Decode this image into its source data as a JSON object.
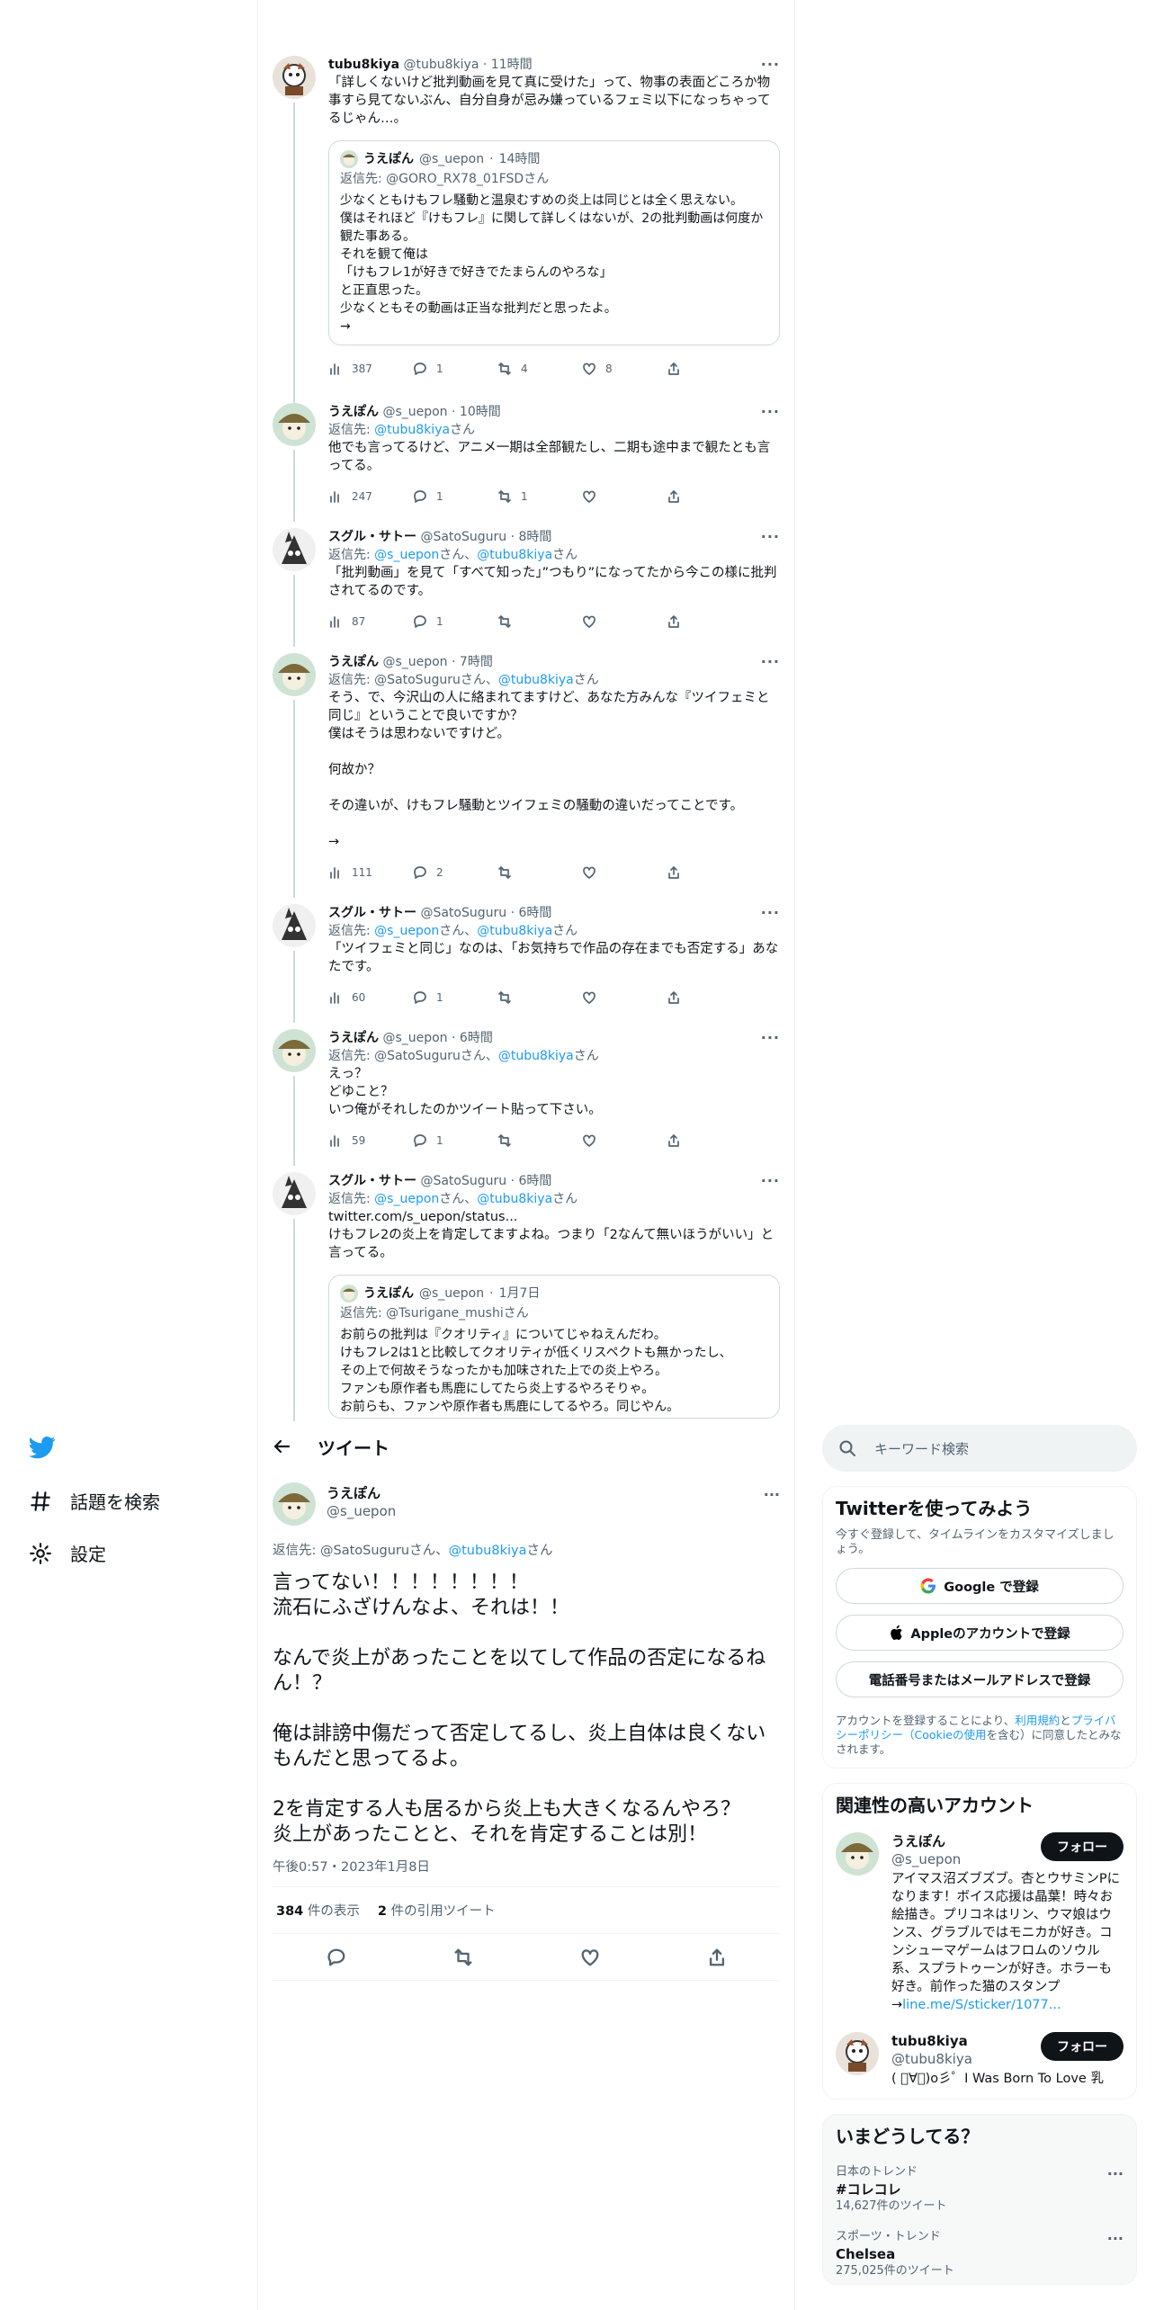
{
  "colors": {
    "accent": "#1d9bf0",
    "text": "#0f1419",
    "muted": "#536471",
    "border": "#eff3f4"
  },
  "thread": [
    {
      "name": "tubu8kiya",
      "handle": "@tubu8kiya",
      "time": "11時間",
      "reply_prefix": "",
      "reply_links": [],
      "body": "「詳しくないけど批判動画を見て真に受けた」って、物事の表面どころか物事すら見てないぶん、自分自身が忌み嫌っているフェミ以下になっちゃってるじゃん…。",
      "quote": {
        "name": "うえぽん",
        "handle": "@s_uepon",
        "time": "14時間",
        "reply": "返信先: @GORO_RX78_01FSDさん",
        "body": "少なくともけもフレ騒動と温泉むすめの炎上は同じとは全く思えない。\n僕はそれほど『けもフレ』に関して詳しくはないが、2の批判動画は何度か観た事ある。\nそれを観て俺は\n「けもフレ1が好きで好きでたまらんのやろな」\nと正直思った。\n少なくともその動画は正当な批判だと思ったよ。\n→"
      },
      "stats": {
        "views": "387",
        "replies": "1",
        "retweets": "4",
        "likes": "8"
      }
    },
    {
      "name": "うえぽん",
      "handle": "@s_uepon",
      "time": "10時間",
      "reply_prefix": "返信先:",
      "reply_links": [
        "@tubu8kiya"
      ],
      "reply_suffix": "さん",
      "body": "他でも言ってるけど、アニメ一期は全部観たし、二期も途中まで観たとも言ってる。",
      "stats": {
        "views": "247",
        "replies": "1",
        "retweets": "1",
        "likes": ""
      }
    },
    {
      "name": "スグル・サトー",
      "handle": "@SatoSuguru",
      "time": "8時間",
      "reply_prefix": "返信先:",
      "reply_text": "@s_uepon",
      "reply_mid": "さん、",
      "reply_text2": "@tubu8kiya",
      "reply_suffix": "さん",
      "body": "「批判動画」を見て「すべて知った」”つもり”になってたから今この様に批判されてるのです。",
      "stats": {
        "views": "87",
        "replies": "1",
        "retweets": "",
        "likes": ""
      }
    },
    {
      "name": "うえぽん",
      "handle": "@s_uepon",
      "time": "7時間",
      "reply_prefix": "返信先: @SatoSuguruさん、",
      "reply_text2": "@tubu8kiya",
      "reply_suffix": "さん",
      "body": "そう、で、今沢山の人に絡まれてますけど、あなた方みんな『ツイフェミと同じ』ということで良いですか？\n僕はそうは思わないですけど。\n\n何故か？\n\nその違いが、けもフレ騒動とツイフェミの騒動の違いだってことです。\n\n→",
      "stats": {
        "views": "111",
        "replies": "2",
        "retweets": "",
        "likes": ""
      }
    },
    {
      "name": "スグル・サトー",
      "handle": "@SatoSuguru",
      "time": "6時間",
      "reply_prefix": "返信先:",
      "reply_text": "@s_uepon",
      "reply_mid": "さん、",
      "reply_text2": "@tubu8kiya",
      "reply_suffix": "さん",
      "body": "「ツイフェミと同じ」なのは、「お気持ちで作品の存在までも否定する」あなたです。",
      "stats": {
        "views": "60",
        "replies": "1",
        "retweets": "",
        "likes": ""
      }
    },
    {
      "name": "うえぽん",
      "handle": "@s_uepon",
      "time": "6時間",
      "reply_prefix": "返信先: @SatoSuguruさん、",
      "reply_text2": "@tubu8kiya",
      "reply_suffix": "さん",
      "body": "えっ？\nどゆこと？\nいつ俺がそれしたのかツイート貼って下さい。",
      "stats": {
        "views": "59",
        "replies": "1",
        "retweets": "",
        "likes": ""
      }
    },
    {
      "name": "スグル・サトー",
      "handle": "@SatoSuguru",
      "time": "6時間",
      "reply_prefix": "返信先:",
      "reply_text": "@s_uepon",
      "reply_mid": "さん、",
      "reply_text2": "@tubu8kiya",
      "reply_suffix": "さん",
      "link": "twitter.com/s_uepon/status...",
      "body": "けもフレ2の炎上を肯定してますよね。つまり「2なんて無いほうがいい」と言ってる。",
      "quote": {
        "name": "うえぽん",
        "handle": "@s_uepon",
        "time": "1月7日",
        "reply": "返信先: @Tsurigane_mushiさん",
        "body": "お前らの批判は『クオリティ』についてじゃねえんだわ。\nけもフレ2は1と比較してクオリティが低くリスペクトも無かったし、\nその上で何故そうなったかも加味された上での炎上やろ。\nファンも原作者も馬鹿にしてたら炎上するやろそりゃ。\nお前らも、ファンや原作者も馬鹿にしてるやろ。同じやん。"
      }
    }
  ],
  "nav": {
    "explore": "話題を検索",
    "settings": "設定"
  },
  "main": {
    "header": "ツイート",
    "name": "うえぽん",
    "handle": "@s_uepon",
    "reply_prefix": "返信先: @SatoSuguruさん、",
    "reply_link": "@tubu8kiya",
    "reply_suffix": "さん",
    "body": "言ってない！！！！！！！！\n流石にふざけんなよ、それは！！\n\nなんで炎上があったことを以てして作品の否定になるねん！？\n\n俺は誹謗中傷だって否定してるし、炎上自体は良くないもんだと思ってるよ。\n\n2を肯定する人も居るから炎上も大きくなるんやろ？\n炎上があったことと、それを肯定することは別！",
    "time": "午後0:57・2023年1月8日",
    "views_count": "384",
    "views_label": "件の表示",
    "quotes_count": "2",
    "quotes_label": "件の引用ツイート"
  },
  "sidebar": {
    "search_placeholder": "キーワード検索",
    "signup": {
      "title": "Twitterを使ってみよう",
      "subtitle": "今すぐ登録して、タイムラインをカスタマイズしましょう。",
      "google": "Google で登録",
      "apple": "Appleのアカウントで登録",
      "phone": "電話番号またはメールアドレスで登録",
      "legal_1": "アカウントを登録することにより、",
      "legal_terms": "利用規約",
      "legal_2": "と",
      "legal_privacy": "プライバシーポリシー",
      "legal_cookie": "（Cookieの使用",
      "legal_3": "を含む）に同意したとみなされます。"
    },
    "relevant": {
      "title": "関連性の高いアカウント",
      "follow": "フォロー",
      "accounts": [
        {
          "name": "うえぽん",
          "handle": "@s_uepon",
          "bio": "アイマス沼ズブズブ。杏とウサミンPになります！ボイス応援は晶葉！時々お絵描き。プリコネはリン、ウマ娘はウンス、グラブルではモニカが好き。コンシューマゲームはフロムのソウル系、スプラトゥーンが好き。ホラーも好き。前作った猫のスタンプ\n→",
          "bio_link": "line.me/S/sticker/1077..."
        },
        {
          "name": "tubu8kiya",
          "handle": "@tubu8kiya",
          "bio": "( ﾟ∀ﾟ)o彡゜I Was Born To Love 乳"
        }
      ]
    },
    "trends": {
      "title": "いまどうしてる？",
      "items": [
        {
          "category": "日本のトレンド",
          "name": "#コレコレ",
          "count": "14,627件のツイート"
        },
        {
          "category": "スポーツ・トレンド",
          "name": "Chelsea",
          "count": "275,025件のツイート"
        }
      ]
    }
  }
}
